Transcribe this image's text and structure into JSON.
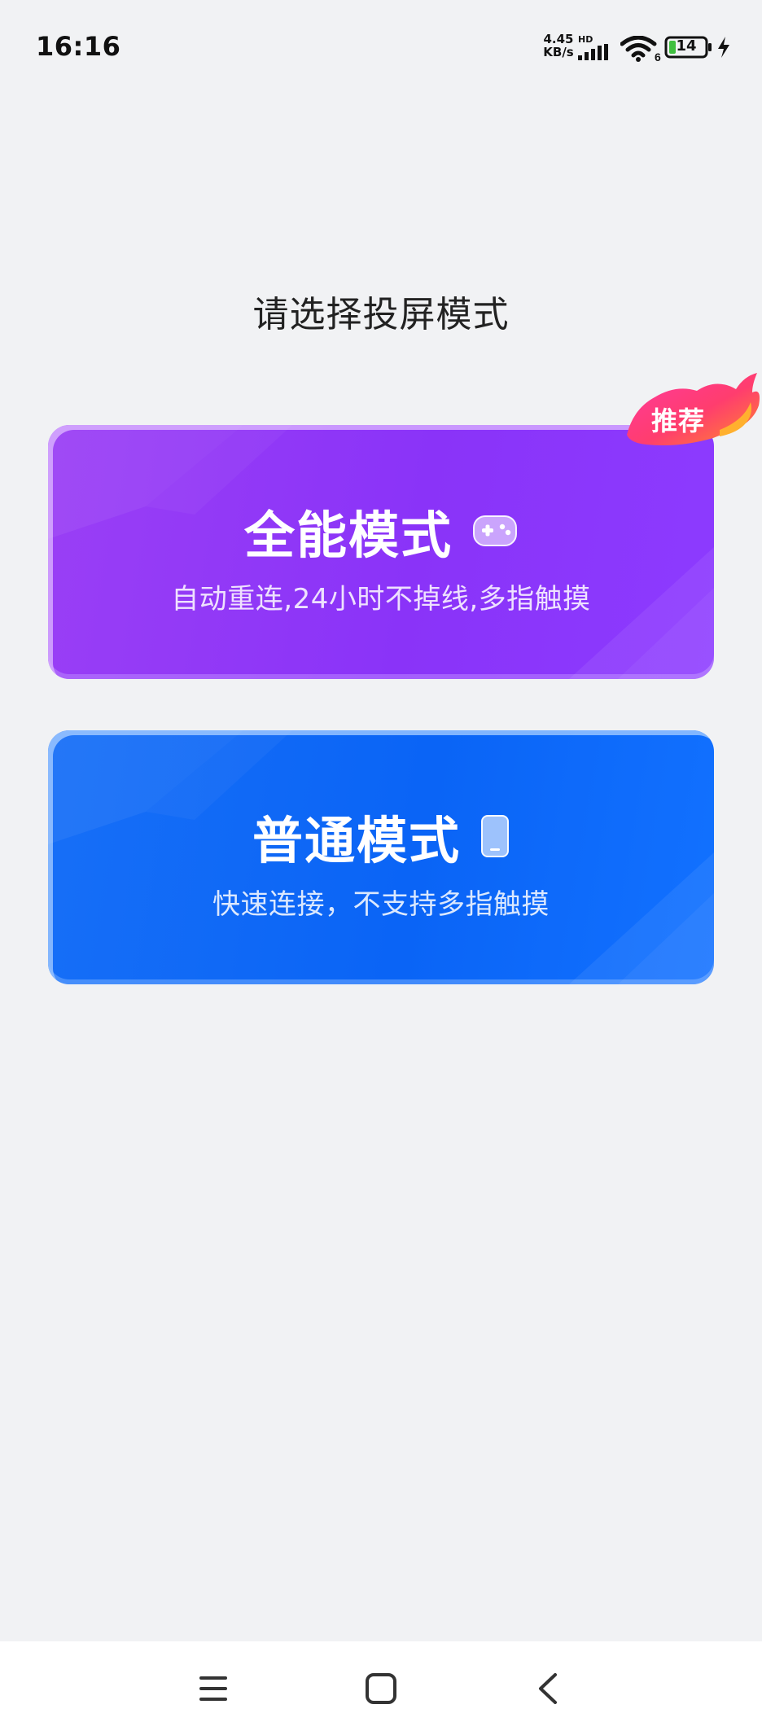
{
  "status": {
    "time": "16:16",
    "net_speed_value": "4.45",
    "net_speed_unit": "KB/s",
    "hd_tag": "HD",
    "wifi_badge": "6",
    "battery": "14",
    "icons": [
      "signal-icon",
      "wifi-icon",
      "battery-icon",
      "charging-icon"
    ]
  },
  "page": {
    "title": "请选择投屏模式"
  },
  "modes": [
    {
      "title": "全能模式",
      "subtitle": "自动重连,24小时不掉线,多指触摸",
      "icon": "gamepad-icon",
      "badge": "推荐",
      "color": "#8a33f8"
    },
    {
      "title": "普通模式",
      "subtitle": "快速连接，不支持多指触摸",
      "icon": "phone-icon",
      "color": "#0a64f6"
    }
  ],
  "nav": {
    "icons": [
      "menu-icon",
      "home-icon",
      "back-icon"
    ]
  }
}
